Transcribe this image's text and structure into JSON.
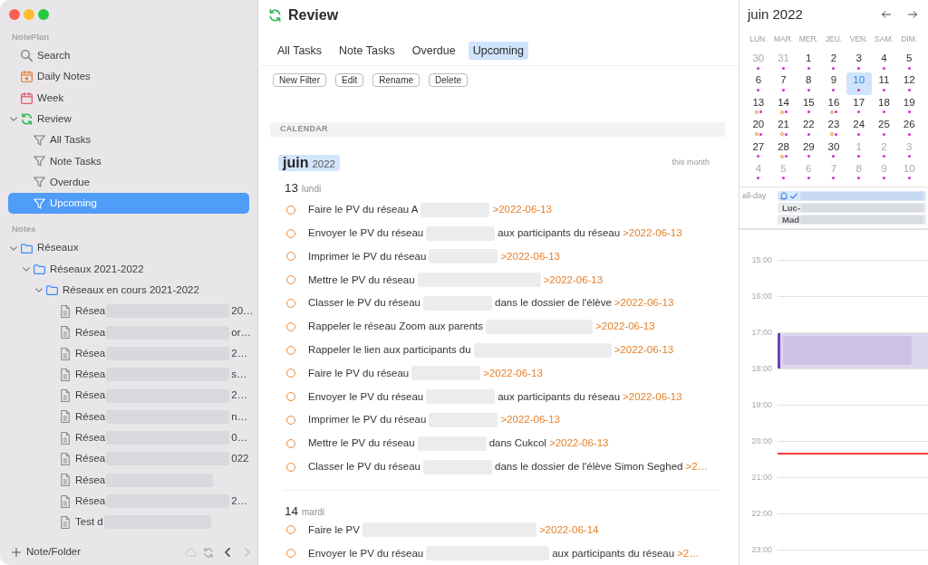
{
  "sidebar": {
    "sections": [
      {
        "title": "NotePlan",
        "items": [
          {
            "kind": "search",
            "label": "Search",
            "selected": false
          },
          {
            "kind": "daily",
            "label": "Daily Notes",
            "selected": false
          },
          {
            "kind": "week",
            "label": "Week",
            "selected": false
          },
          {
            "kind": "review",
            "label": "Review",
            "selected": false,
            "expanded": true,
            "children": [
              {
                "kind": "filter",
                "label": "All Tasks",
                "selected": false
              },
              {
                "kind": "filter",
                "label": "Note Tasks",
                "selected": false
              },
              {
                "kind": "filter",
                "label": "Overdue",
                "selected": false
              },
              {
                "kind": "filter",
                "label": "Upcoming",
                "selected": true
              }
            ]
          }
        ]
      },
      {
        "title": "Notes",
        "items": [
          {
            "kind": "folder",
            "label": "Réseaux",
            "selected": false,
            "expanded": true,
            "children": [
              {
                "kind": "folder",
                "label": "Réseaux 2021-2022",
                "selected": false,
                "expanded": true,
                "children": [
                  {
                    "kind": "folder",
                    "label": "Réseaux en cours 2021-2022",
                    "selected": false,
                    "expanded": true,
                    "children": [
                      {
                        "kind": "note",
                        "selected": false,
                        "segments": [
                          {
                            "kind": "text",
                            "text": "Résea"
                          },
                          {
                            "kind": "redacted_long"
                          },
                          {
                            "kind": "text",
                            "text": "20…"
                          }
                        ]
                      },
                      {
                        "kind": "note",
                        "selected": false,
                        "segments": [
                          {
                            "kind": "text",
                            "text": "Résea"
                          },
                          {
                            "kind": "redacted_long"
                          },
                          {
                            "kind": "text",
                            "text": "or…"
                          }
                        ]
                      },
                      {
                        "kind": "note",
                        "selected": false,
                        "segments": [
                          {
                            "kind": "text",
                            "text": "Résea"
                          },
                          {
                            "kind": "redacted_long"
                          },
                          {
                            "kind": "text",
                            "text": "2…"
                          }
                        ]
                      },
                      {
                        "kind": "note",
                        "selected": false,
                        "segments": [
                          {
                            "kind": "text",
                            "text": "Résea"
                          },
                          {
                            "kind": "redacted_long"
                          },
                          {
                            "kind": "text",
                            "text": "s…"
                          }
                        ]
                      },
                      {
                        "kind": "note",
                        "selected": false,
                        "segments": [
                          {
                            "kind": "text",
                            "text": "Résea"
                          },
                          {
                            "kind": "redacted_long"
                          },
                          {
                            "kind": "text",
                            "text": "2…"
                          }
                        ]
                      },
                      {
                        "kind": "note",
                        "selected": false,
                        "segments": [
                          {
                            "kind": "text",
                            "text": "Résea"
                          },
                          {
                            "kind": "redacted_long"
                          },
                          {
                            "kind": "text",
                            "text": "n…"
                          }
                        ]
                      },
                      {
                        "kind": "note",
                        "selected": false,
                        "segments": [
                          {
                            "kind": "text",
                            "text": "Résea"
                          },
                          {
                            "kind": "redacted_long"
                          },
                          {
                            "kind": "text",
                            "text": "0…"
                          }
                        ]
                      },
                      {
                        "kind": "note",
                        "selected": false,
                        "segments": [
                          {
                            "kind": "text",
                            "text": "Résea"
                          },
                          {
                            "kind": "redacted_long"
                          },
                          {
                            "kind": "text",
                            "text": "022"
                          }
                        ]
                      },
                      {
                        "kind": "note",
                        "selected": false,
                        "segments": [
                          {
                            "kind": "text",
                            "text": "Résea"
                          },
                          {
                            "kind": "redacted_medium"
                          }
                        ]
                      },
                      {
                        "kind": "note",
                        "selected": false,
                        "segments": [
                          {
                            "kind": "text",
                            "text": "Résea"
                          },
                          {
                            "kind": "redacted_long"
                          },
                          {
                            "kind": "text",
                            "text": "2…"
                          }
                        ]
                      },
                      {
                        "kind": "note",
                        "selected": false,
                        "segments": [
                          {
                            "kind": "text",
                            "text": "Test d"
                          },
                          {
                            "kind": "redacted_medium"
                          }
                        ]
                      }
                    ]
                  }
                ]
              }
            ]
          }
        ]
      }
    ],
    "footer": {
      "add_label": "Note/Folder",
      "back": {
        "disabled": false
      },
      "forward": {
        "disabled": true
      }
    }
  },
  "main": {
    "title": "Review",
    "tabs": [
      {
        "label": "All Tasks",
        "selected": false
      },
      {
        "label": "Note Tasks",
        "selected": false
      },
      {
        "label": "Overdue",
        "selected": false
      },
      {
        "label": "Upcoming",
        "selected": true
      }
    ],
    "buttons": [
      "New Filter",
      "Edit",
      "Rename",
      "Delete"
    ],
    "section": "CALENDAR",
    "month": {
      "name": "juin",
      "year": "2022",
      "note": "this month"
    },
    "days": [
      {
        "number": "13",
        "weekday": "lundi",
        "tasks": [
          {
            "checked": false,
            "segments": [
              {
                "kind": "text",
                "text": "Faire le PV du réseau A"
              },
              {
                "kind": "redacted_short"
              },
              {
                "kind": "date",
                "text": ">2022-06-13"
              }
            ]
          },
          {
            "checked": false,
            "segments": [
              {
                "kind": "text",
                "text": "Envoyer le PV du réseau"
              },
              {
                "kind": "redacted_short"
              },
              {
                "kind": "text",
                "text": "aux participants du réseau"
              },
              {
                "kind": "date",
                "text": ">2022-06-13"
              }
            ]
          },
          {
            "checked": false,
            "segments": [
              {
                "kind": "text",
                "text": "Imprimer le PV du réseau"
              },
              {
                "kind": "redacted_short"
              },
              {
                "kind": "date",
                "text": ">2022-06-13"
              }
            ]
          },
          {
            "checked": false,
            "segments": [
              {
                "kind": "text",
                "text": "Mettre le PV du réseau"
              },
              {
                "kind": "redacted_long"
              },
              {
                "kind": "date",
                "text": ">2022-06-13"
              }
            ]
          },
          {
            "checked": false,
            "segments": [
              {
                "kind": "text",
                "text": "Classer le PV du réseau"
              },
              {
                "kind": "redacted_short"
              },
              {
                "kind": "text",
                "text": "dans le dossier de l'élève"
              },
              {
                "kind": "date",
                "text": ">2022-06-13"
              }
            ]
          },
          {
            "checked": false,
            "segments": [
              {
                "kind": "text",
                "text": "Rappeler le réseau Zoom aux parents"
              },
              {
                "kind": "redacted_medium"
              },
              {
                "kind": "date",
                "text": ">2022-06-13"
              }
            ]
          },
          {
            "checked": false,
            "segments": [
              {
                "kind": "text",
                "text": "Rappeler le lien aux participants du"
              },
              {
                "kind": "redacted_xlong"
              },
              {
                "kind": "date",
                "text": ">2022-06-13"
              }
            ]
          },
          {
            "checked": false,
            "segments": [
              {
                "kind": "text",
                "text": "Faire le PV du réseau"
              },
              {
                "kind": "redacted_short"
              },
              {
                "kind": "date",
                "text": ">2022-06-13"
              }
            ]
          },
          {
            "checked": false,
            "segments": [
              {
                "kind": "text",
                "text": "Envoyer le PV du réseau"
              },
              {
                "kind": "redacted_short"
              },
              {
                "kind": "text",
                "text": "aux participants du réseau"
              },
              {
                "kind": "date",
                "text": ">2022-06-13"
              }
            ]
          },
          {
            "checked": false,
            "segments": [
              {
                "kind": "text",
                "text": "Imprimer le PV du réseau"
              },
              {
                "kind": "redacted_short"
              },
              {
                "kind": "date",
                "text": ">2022-06-13"
              }
            ]
          },
          {
            "checked": false,
            "segments": [
              {
                "kind": "text",
                "text": "Mettre le PV du réseau"
              },
              {
                "kind": "redacted_short"
              },
              {
                "kind": "text",
                "text": "dans Cukcol"
              },
              {
                "kind": "date",
                "text": ">2022-06-13"
              }
            ]
          },
          {
            "checked": false,
            "segments": [
              {
                "kind": "text",
                "text": "Classer le PV du réseau"
              },
              {
                "kind": "redacted_short"
              },
              {
                "kind": "text",
                "text": "dans le dossier de l'élève Simon Seghed"
              },
              {
                "kind": "date",
                "text": ">2…"
              }
            ]
          }
        ]
      },
      {
        "number": "14",
        "weekday": "mardi",
        "tasks": [
          {
            "checked": false,
            "segments": [
              {
                "kind": "text",
                "text": "Faire le PV"
              },
              {
                "kind": "redacted_xxlong"
              },
              {
                "kind": "date",
                "text": ">2022-06-14"
              }
            ]
          },
          {
            "checked": false,
            "segments": [
              {
                "kind": "text",
                "text": "Envoyer le PV du réseau"
              },
              {
                "kind": "redacted_long"
              },
              {
                "kind": "text",
                "text": "aux participants du réseau"
              },
              {
                "kind": "date",
                "text": ">2…"
              }
            ]
          }
        ]
      }
    ]
  },
  "calendar": {
    "title": "juin 2022",
    "weekdays": [
      "LUN.",
      "MAR.",
      "MER.",
      "JEU.",
      "VEN.",
      "SAM.",
      "DIM."
    ],
    "days": [
      {
        "label": "30",
        "outside": true,
        "selected": false,
        "task": false,
        "event": true
      },
      {
        "label": "31",
        "outside": true,
        "selected": false,
        "task": false,
        "event": true
      },
      {
        "label": "1",
        "outside": false,
        "selected": false,
        "task": false,
        "event": true
      },
      {
        "label": "2",
        "outside": false,
        "selected": false,
        "task": false,
        "event": true
      },
      {
        "label": "3",
        "outside": false,
        "selected": false,
        "task": false,
        "event": true
      },
      {
        "label": "4",
        "outside": false,
        "selected": false,
        "task": false,
        "event": true
      },
      {
        "label": "5",
        "outside": false,
        "selected": false,
        "task": false,
        "event": true
      },
      {
        "label": "6",
        "outside": false,
        "selected": false,
        "task": false,
        "event": true
      },
      {
        "label": "7",
        "outside": false,
        "selected": false,
        "task": false,
        "event": true
      },
      {
        "label": "8",
        "outside": false,
        "selected": false,
        "task": false,
        "event": true
      },
      {
        "label": "9",
        "outside": false,
        "selected": false,
        "task": false,
        "event": true
      },
      {
        "label": "10",
        "outside": false,
        "selected": true,
        "task": false,
        "event": true
      },
      {
        "label": "11",
        "outside": false,
        "selected": false,
        "task": false,
        "event": true
      },
      {
        "label": "12",
        "outside": false,
        "selected": false,
        "task": false,
        "event": true
      },
      {
        "label": "13",
        "outside": false,
        "selected": false,
        "task": true,
        "event": true
      },
      {
        "label": "14",
        "outside": false,
        "selected": false,
        "task": true,
        "event": true
      },
      {
        "label": "15",
        "outside": false,
        "selected": false,
        "task": false,
        "event": true
      },
      {
        "label": "16",
        "outside": false,
        "selected": false,
        "task": true,
        "event": true
      },
      {
        "label": "17",
        "outside": false,
        "selected": false,
        "task": false,
        "event": true
      },
      {
        "label": "18",
        "outside": false,
        "selected": false,
        "task": false,
        "event": true
      },
      {
        "label": "19",
        "outside": false,
        "selected": false,
        "task": false,
        "event": true
      },
      {
        "label": "20",
        "outside": false,
        "selected": false,
        "task": true,
        "event": true
      },
      {
        "label": "21",
        "outside": false,
        "selected": false,
        "task": true,
        "event": true
      },
      {
        "label": "22",
        "outside": false,
        "selected": false,
        "task": false,
        "event": true
      },
      {
        "label": "23",
        "outside": false,
        "selected": false,
        "task": true,
        "event": true
      },
      {
        "label": "24",
        "outside": false,
        "selected": false,
        "task": false,
        "event": true
      },
      {
        "label": "25",
        "outside": false,
        "selected": false,
        "task": false,
        "event": true
      },
      {
        "label": "26",
        "outside": false,
        "selected": false,
        "task": false,
        "event": true
      },
      {
        "label": "27",
        "outside": false,
        "selected": false,
        "task": false,
        "event": true
      },
      {
        "label": "28",
        "outside": false,
        "selected": false,
        "task": true,
        "event": true
      },
      {
        "label": "29",
        "outside": false,
        "selected": false,
        "task": false,
        "event": true
      },
      {
        "label": "30",
        "outside": false,
        "selected": false,
        "task": false,
        "event": true
      },
      {
        "label": "1",
        "outside": true,
        "selected": false,
        "task": false,
        "event": true
      },
      {
        "label": "2",
        "outside": true,
        "selected": false,
        "task": false,
        "event": true
      },
      {
        "label": "3",
        "outside": true,
        "selected": false,
        "task": false,
        "event": true
      },
      {
        "label": "4",
        "outside": true,
        "selected": false,
        "task": false,
        "event": true
      },
      {
        "label": "5",
        "outside": true,
        "selected": false,
        "task": false,
        "event": true
      },
      {
        "label": "6",
        "outside": true,
        "selected": false,
        "task": false,
        "event": true
      },
      {
        "label": "7",
        "outside": true,
        "selected": false,
        "task": false,
        "event": true
      },
      {
        "label": "8",
        "outside": true,
        "selected": false,
        "task": false,
        "event": true
      },
      {
        "label": "9",
        "outside": true,
        "selected": false,
        "task": false,
        "event": true
      },
      {
        "label": "10",
        "outside": true,
        "selected": false,
        "task": false,
        "event": true
      }
    ],
    "all_day": {
      "label": "all-day",
      "events": [
        {
          "kind": "reminder"
        },
        {
          "kind": "event",
          "text": "Luc-"
        },
        {
          "kind": "event",
          "text": "Mad"
        }
      ]
    },
    "hours": [
      {
        "label": "15:00",
        "now": false
      },
      {
        "label": "16:00",
        "now": false
      },
      {
        "label": "17:00",
        "now": false,
        "events": [
          {
            "kind": "redacted"
          }
        ]
      },
      {
        "label": "18:00",
        "now": false
      },
      {
        "label": "19:00",
        "now": false
      },
      {
        "label": "20:00",
        "now": true
      },
      {
        "label": "21:00",
        "now": false
      },
      {
        "label": "22:00",
        "now": false
      },
      {
        "label": "23:00",
        "now": false
      }
    ]
  }
}
